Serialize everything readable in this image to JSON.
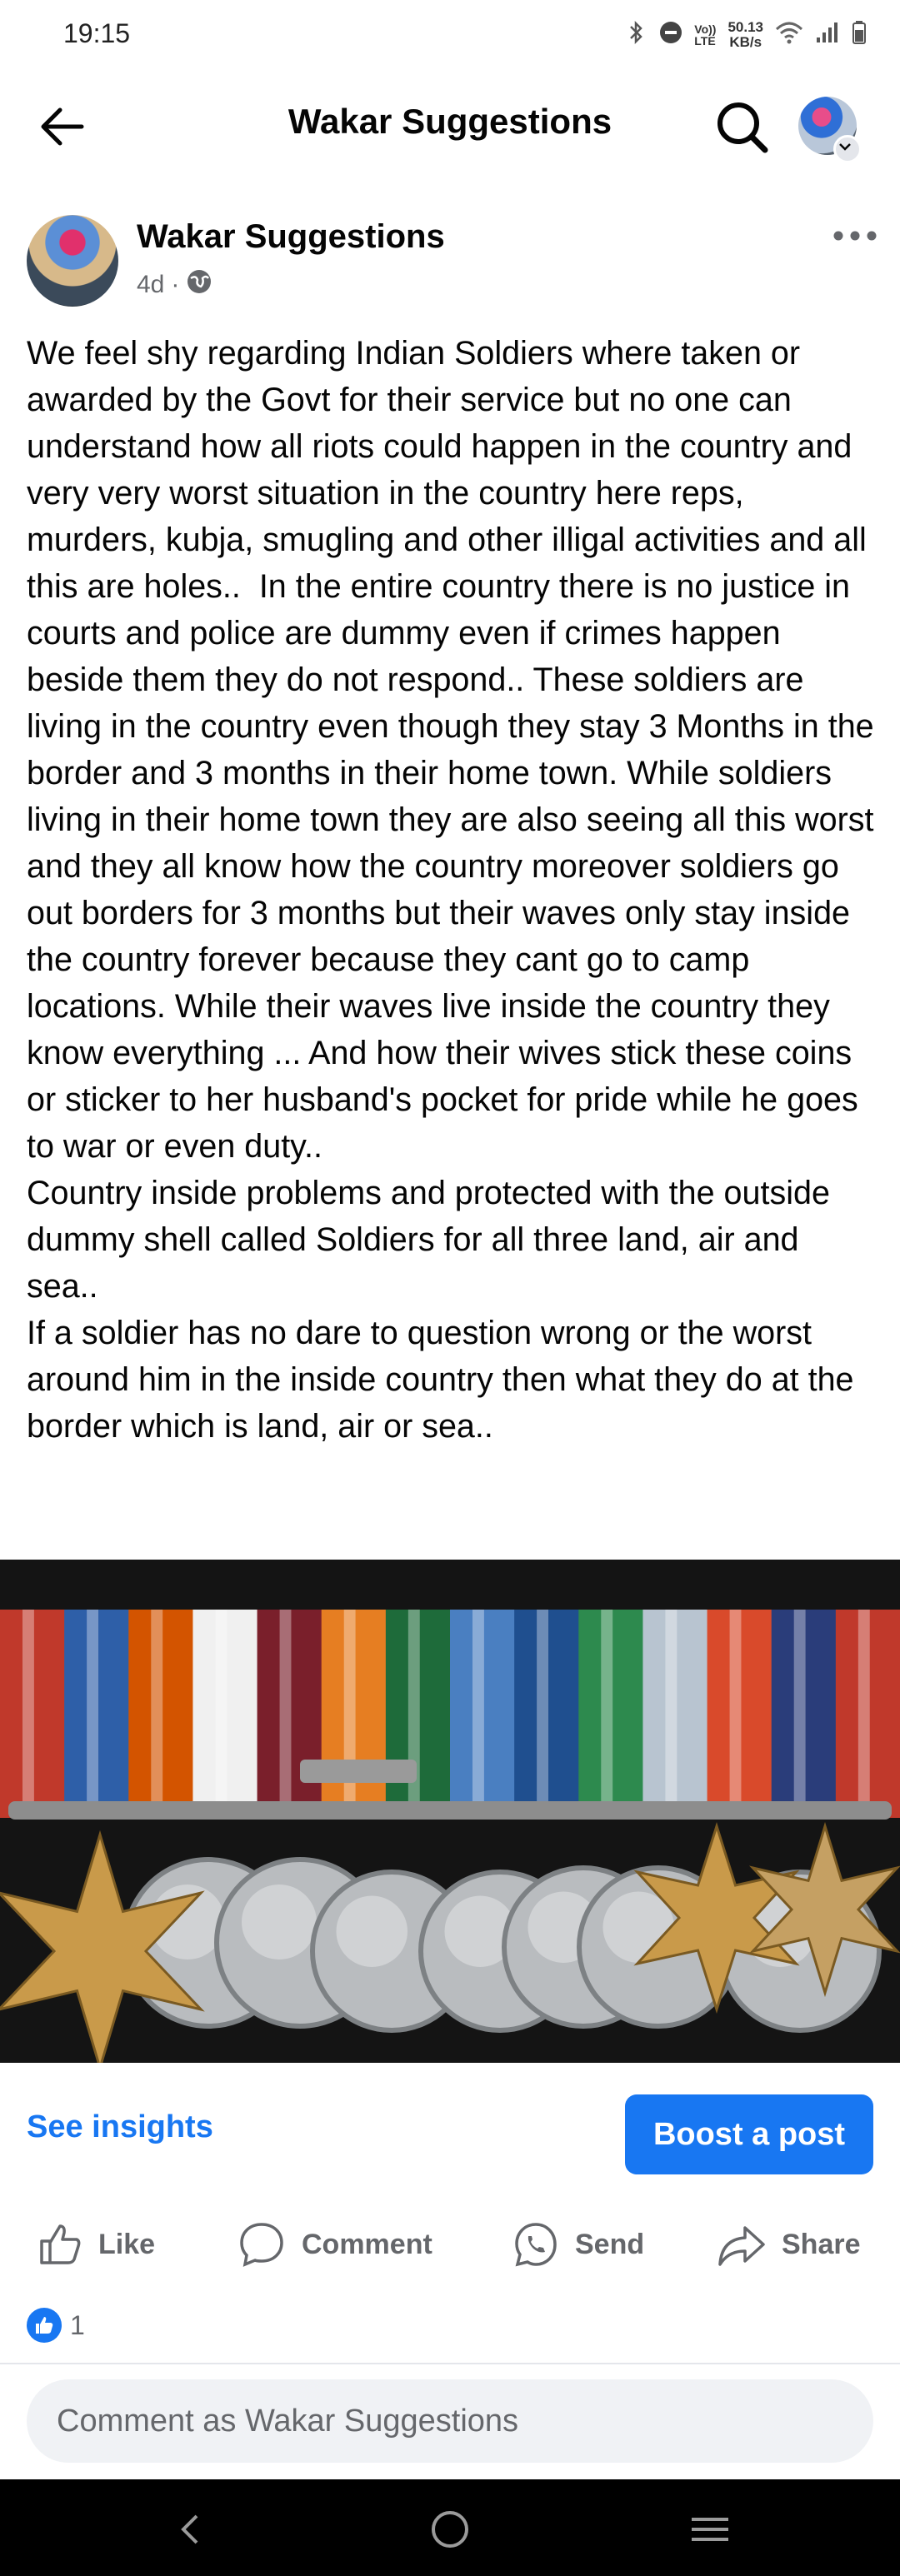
{
  "status_bar": {
    "time": "19:15",
    "network_speed_value": "50.13",
    "network_speed_unit": "KB/s",
    "volte_top": "Vo))",
    "volte_bottom": "LTE"
  },
  "header": {
    "title": "Wakar Suggestions"
  },
  "post": {
    "author": "Wakar Suggestions",
    "time_ago": "4d",
    "separator": "·",
    "text": "We feel shy regarding Indian Soldiers where taken or awarded by the Govt for their service but no one can understand how all riots could happen in the country and very very worst situation in the country here reps, murders, kubja, smugling and other illigal activities and all this are holes..  In the entire country there is no justice in courts and police are dummy even if crimes happen beside them they do not respond.. These soldiers are living in the country even though they stay 3 Months in the border and 3 months in their home town. While soldiers living in their home town they are also seeing all this worst and they all know how the country moreover soldiers go out borders for 3 months but their waves only stay inside the country forever because they cant go to camp locations. While their waves live inside the country they know everything ... And how their wives stick these coins or sticker to her husband's pocket for pride while he goes to war or even duty..\nCountry inside problems and protected with the outside dummy shell called Soldiers for all three land, air and sea..\nIf a soldier has no dare to question wrong or the worst around him in the inside country then what they do at the border which is land, air or sea..",
    "image": {
      "ribbon_colors": [
        "#c0392b",
        "#2e5fa8",
        "#d35400",
        "#f0f0f0",
        "#7a1f2b",
        "#e67e22",
        "#1e6b3a",
        "#4a7fc1",
        "#1f4f8f",
        "#2d8a4e",
        "#b8c4d0",
        "#d94a2b",
        "#2a3d7a",
        "#c0392b"
      ]
    }
  },
  "actions": {
    "insights": "See insights",
    "boost": "Boost a post",
    "like": "Like",
    "comment": "Comment",
    "send": "Send",
    "share": "Share",
    "reaction_count": "1",
    "comment_placeholder": "Comment as Wakar Suggestions"
  },
  "colors": {
    "accent": "#1877f2",
    "secondary_text": "#65676b"
  }
}
